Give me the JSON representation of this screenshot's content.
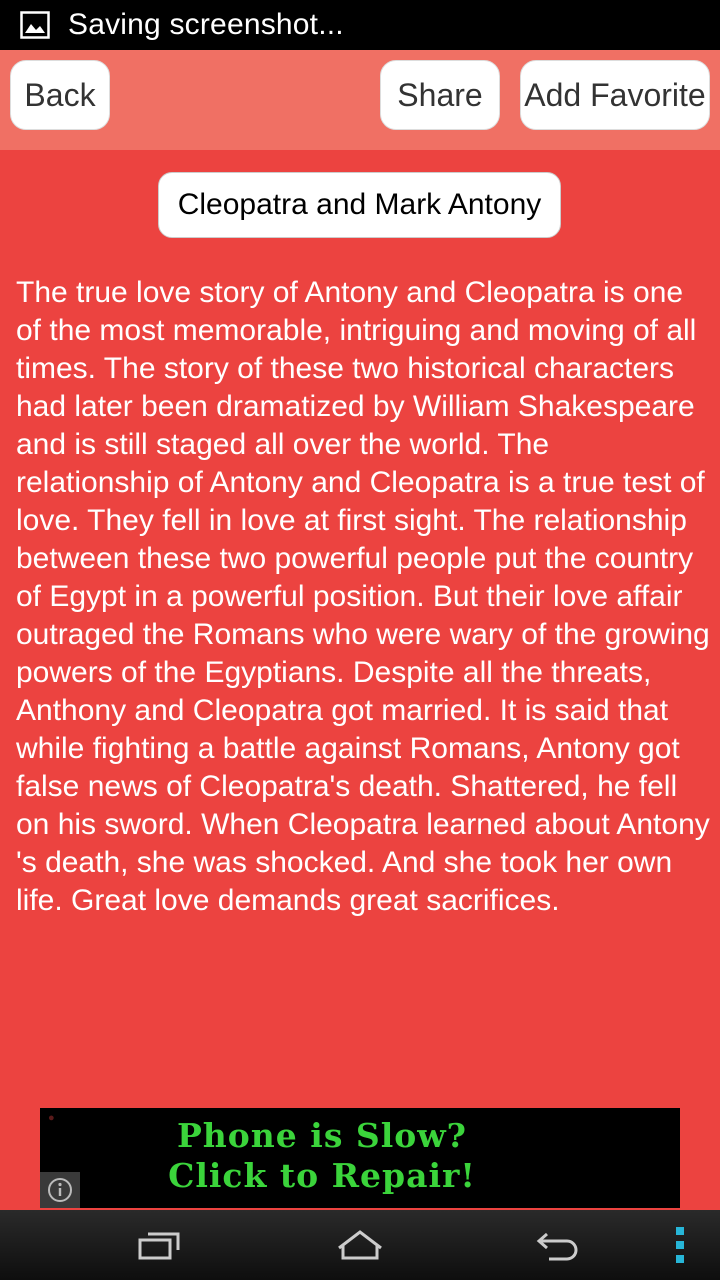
{
  "status_bar": {
    "text": "Saving screenshot...",
    "icon": "image-icon"
  },
  "toolbar": {
    "back_label": "Back",
    "share_label": "Share",
    "favorite_label": "Add Favorite"
  },
  "story": {
    "title": "Cleopatra and Mark Antony",
    "body": "The true love story of Antony and Cleopatra is one of the most memorable, intriguing and moving of all times. The story of these two historical characters had later been dramatized by William Shakespeare and is still staged all over the world. The relationship of Antony and Cleopatra is a true test of love. They fell in love at first sight. The relationship between these two powerful people put the country of Egypt in a powerful position. But their love affair outraged the Romans who were wary of the growing powers of the Egyptians. Despite all the threats, Anthony and Cleopatra got married. It is said that while fighting a battle against Romans, Antony got false news of Cleopatra's death. Shattered, he fell on his sword. When Cleopatra learned about Antony 's death, she was shocked. And she took her own life. Great love demands great sacrifices."
  },
  "ad": {
    "line1": "Phone is Slow?",
    "line2": "Click to Repair!"
  },
  "nav_bar": {
    "icons": [
      "recent-apps-icon",
      "home-icon",
      "back-icon",
      "menu-icon"
    ]
  },
  "colors": {
    "background": "#ec4340",
    "toolbar": "#f07064",
    "ad_text": "#3bd43b"
  }
}
